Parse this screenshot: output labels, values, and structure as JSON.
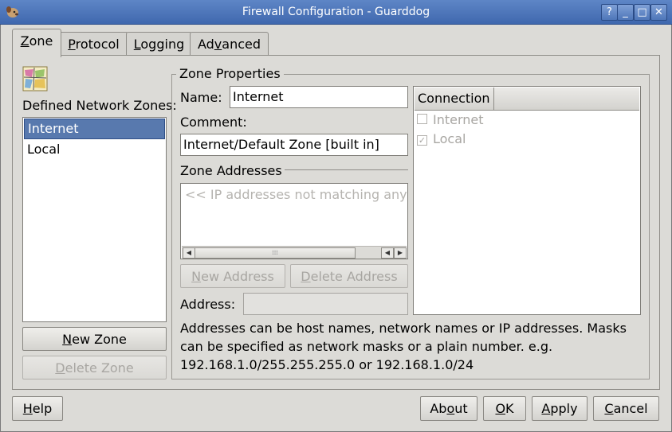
{
  "window": {
    "title": "Firewall Configuration - Guarddog",
    "buttons": {
      "help": "?",
      "minimize": "_",
      "maximize": "□",
      "close": "✕"
    }
  },
  "tabs": [
    {
      "label": "Zone",
      "mnemonic": "Z",
      "rest": "one",
      "active": true
    },
    {
      "label": "Protocol",
      "mnemonic": "P",
      "rest": "rotocol"
    },
    {
      "label": "Logging",
      "mnemonic": "L",
      "rest": "ogging"
    },
    {
      "label": "Advanced",
      "pre": "Ad",
      "mnemonic": "v",
      "rest": "anced"
    }
  ],
  "zones": {
    "label": "Defined Network Zones:",
    "items": [
      "Internet",
      "Local"
    ],
    "selected": "Internet",
    "new_button": {
      "mnemonic": "N",
      "rest": "ew Zone"
    },
    "delete_button": {
      "label": "Delete Zone",
      "mnemonic": "D",
      "rest": "elete Zone"
    }
  },
  "zone_properties": {
    "title": "Zone Properties",
    "name_label": "Name:",
    "name_value": "Internet",
    "comment_label": "Comment:",
    "comment_value": "Internet/Default Zone [built in]",
    "addresses_title": "Zone Addresses",
    "addresses_placeholder": "<< IP addresses not matching any zone >>",
    "new_address": {
      "mnemonic": "N",
      "rest": "ew Address"
    },
    "delete_address": {
      "label": "Delete Address",
      "mnemonic": "D",
      "rest": "elete Address"
    },
    "address_label": "Address:",
    "address_value": "",
    "help_text": "Addresses can be host names, network names or IP addresses. Masks can be specified as network masks or a plain number. e.g. 192.168.1.0/255.255.255.0 or 192.168.1.0/24"
  },
  "connection": {
    "header": "Connection",
    "rows": [
      {
        "label": "Internet",
        "checked": false
      },
      {
        "label": "Local",
        "checked": true
      }
    ]
  },
  "footer": {
    "help": {
      "mnemonic": "H",
      "rest": "elp"
    },
    "about": {
      "pre": "Ab",
      "mnemonic": "o",
      "rest": "ut"
    },
    "ok": {
      "mnemonic": "O",
      "rest": "K"
    },
    "apply": {
      "mnemonic": "A",
      "rest": "pply"
    },
    "cancel": {
      "mnemonic": "C",
      "rest": "ancel"
    }
  },
  "colors": {
    "titlebar": "#4a73b8",
    "selection": "#5879ae",
    "window_bg": "#dcdbd7"
  }
}
